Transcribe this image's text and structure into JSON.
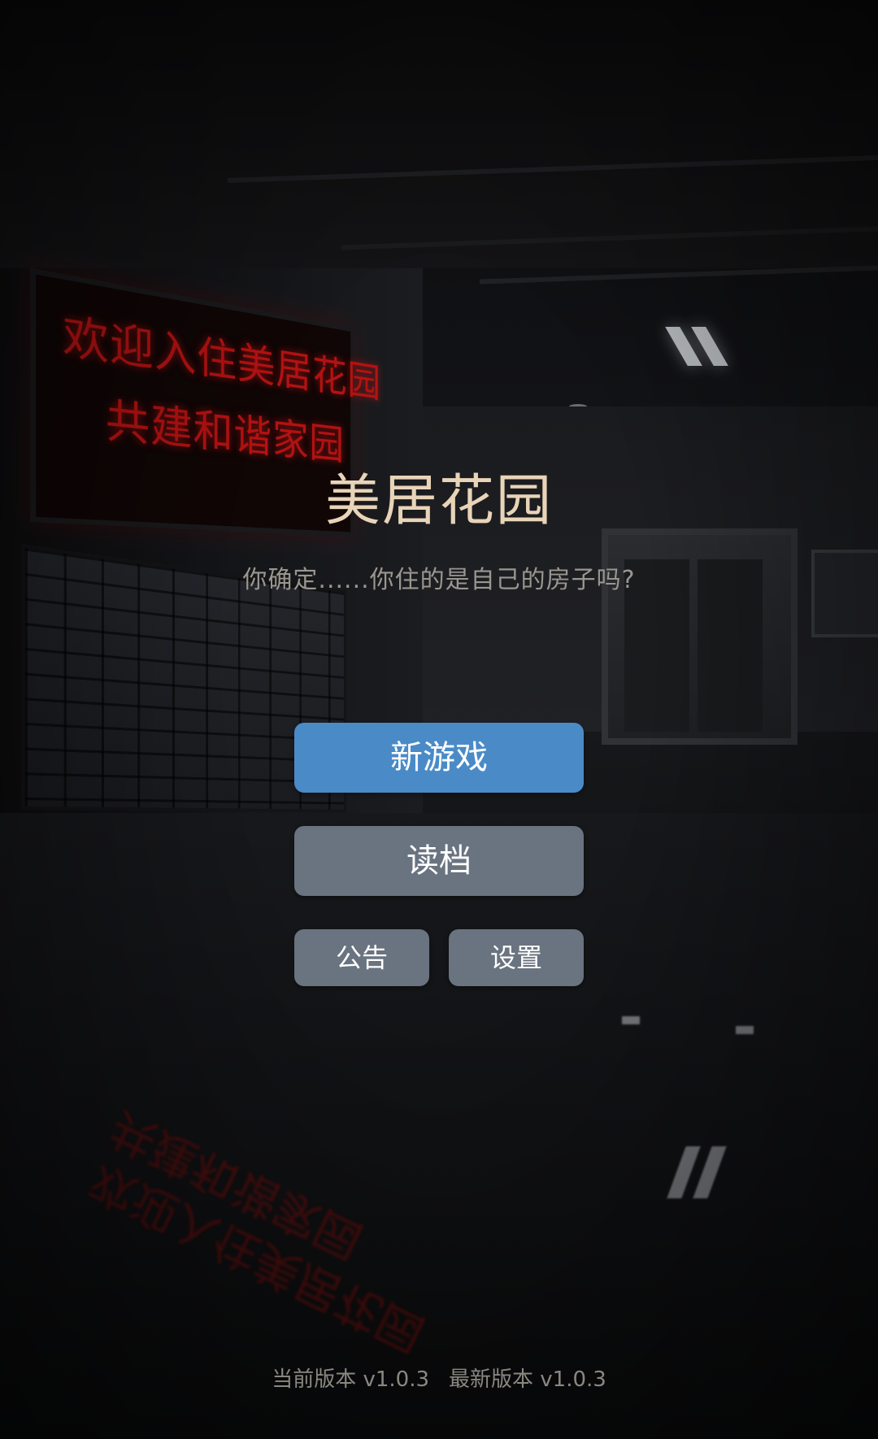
{
  "game": {
    "title": "美居花园",
    "subtitle": "你确定......你住的是自己的房子吗?"
  },
  "background": {
    "led_line_1": "欢迎入住美居花园",
    "led_line_2": "共建和谐家园",
    "led_color": "#b31212"
  },
  "menu": {
    "new_game_label": "新游戏",
    "load_label": "读档",
    "notice_label": "公告",
    "settings_label": "设置",
    "primary_color": "#4a8bc7",
    "secondary_color": "#6a7380"
  },
  "footer": {
    "current_version": "当前版本 v1.0.3",
    "latest_version": "最新版本 v1.0.3"
  }
}
